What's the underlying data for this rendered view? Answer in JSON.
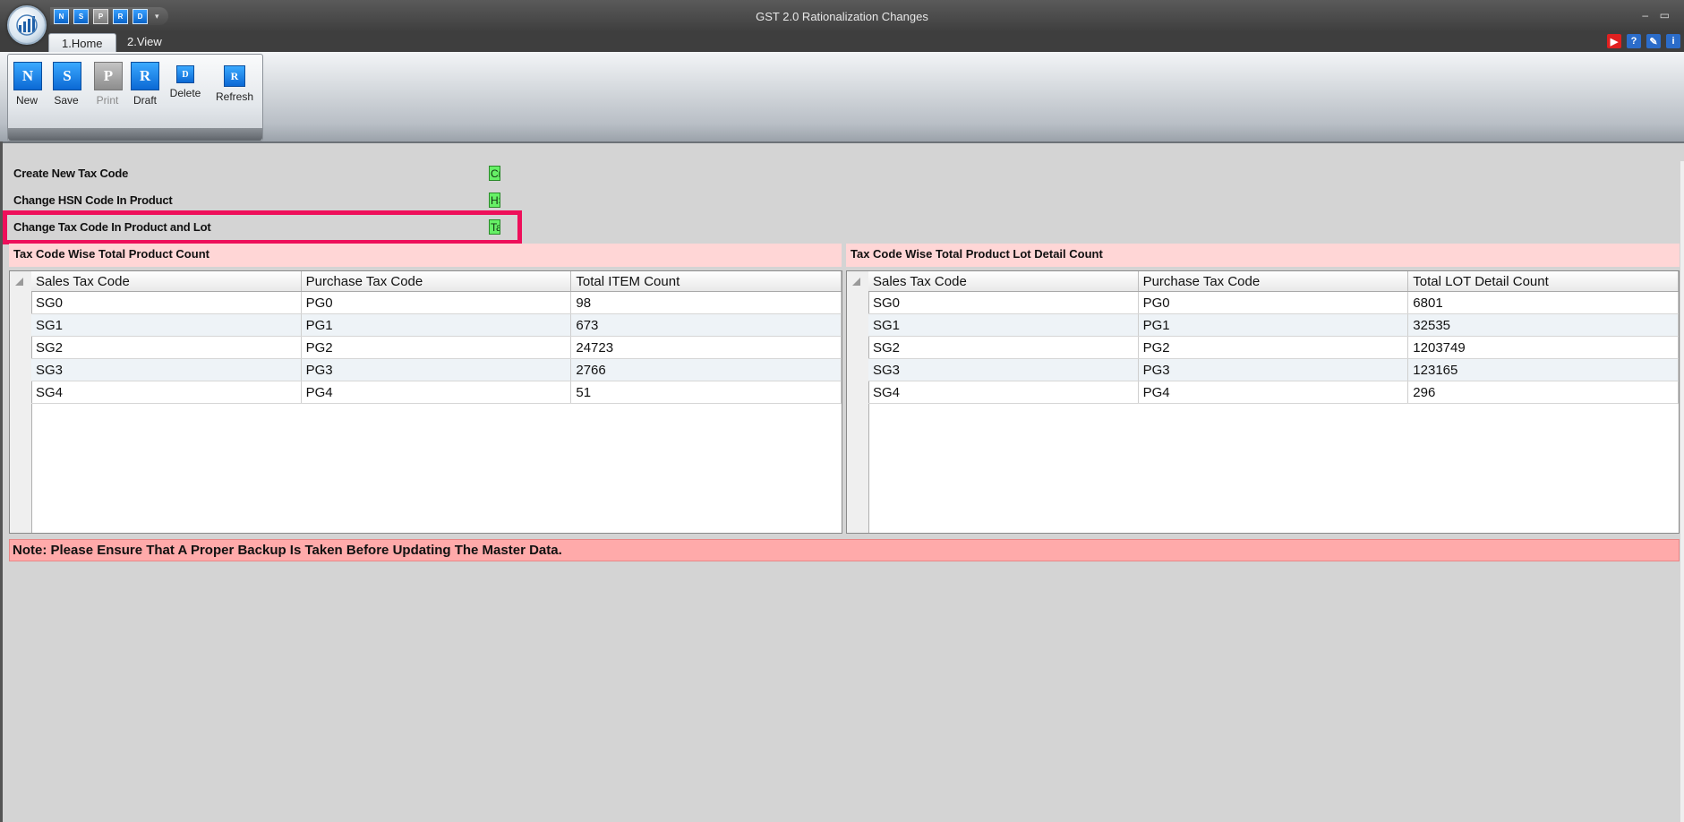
{
  "window": {
    "title": "GST 2.0 Rationalization Changes",
    "minimize": "–",
    "maximize": "▭"
  },
  "quick_access": {
    "items": [
      "N",
      "S",
      "P",
      "R",
      "D"
    ],
    "more": "▾"
  },
  "tabs": [
    {
      "label": "1.Home",
      "active": true
    },
    {
      "label": "2.View",
      "active": false
    }
  ],
  "ribbon": {
    "buttons": [
      {
        "label": "New",
        "glyph": "N",
        "enabled": true
      },
      {
        "label": "Save",
        "glyph": "S",
        "enabled": true
      },
      {
        "label": "Print",
        "glyph": "P",
        "enabled": false
      },
      {
        "label": "Draft",
        "glyph": "R",
        "enabled": true
      },
      {
        "label": "Delete",
        "glyph": "D",
        "enabled": true
      },
      {
        "label": "Refresh",
        "glyph": "R",
        "enabled": true
      }
    ]
  },
  "options": [
    {
      "label": "Create New Tax Code",
      "value": "Cr"
    },
    {
      "label": "Change HSN Code In Product",
      "value": "HS"
    },
    {
      "label": "Change Tax Code In Product and Lot",
      "value": "Ta"
    }
  ],
  "left_panel": {
    "title": "Tax Code Wise Total Product Count",
    "columns": [
      "Sales Tax Code",
      "Purchase Tax Code",
      "Total ITEM Count"
    ],
    "rows": [
      [
        "SG0",
        "PG0",
        "98"
      ],
      [
        "SG1",
        "PG1",
        "673"
      ],
      [
        "SG2",
        "PG2",
        "24723"
      ],
      [
        "SG3",
        "PG3",
        "2766"
      ],
      [
        "SG4",
        "PG4",
        "51"
      ]
    ]
  },
  "right_panel": {
    "title": "Tax Code Wise Total Product Lot Detail Count",
    "columns": [
      "Sales Tax Code",
      "Purchase Tax Code",
      "Total LOT Detail Count"
    ],
    "rows": [
      [
        "SG0",
        "PG0",
        "6801"
      ],
      [
        "SG1",
        "PG1",
        "32535"
      ],
      [
        "SG2",
        "PG2",
        "1203749"
      ],
      [
        "SG3",
        "PG3",
        "123165"
      ],
      [
        "SG4",
        "PG4",
        "296"
      ]
    ]
  },
  "note": "Note: Please Ensure That A Proper Backup Is Taken Before Updating The Master Data.",
  "colors": {
    "highlight": "#ee0f5a",
    "option_box": "#66f066",
    "panel_header": "#ffd6d6",
    "note_bg": "#ffaaaa"
  }
}
